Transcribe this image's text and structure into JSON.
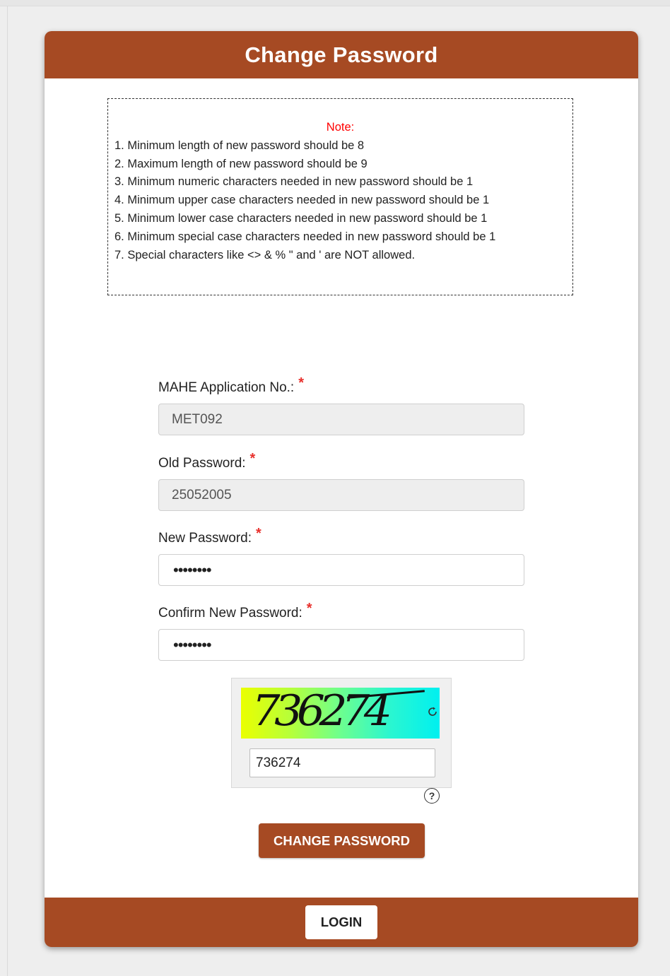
{
  "page": {
    "title": "Change Password"
  },
  "note": {
    "heading": "Note:",
    "lines": [
      "1. Minimum length of new password should be 8",
      "2. Maximum length of new password should be 9",
      "3. Minimum numeric characters needed in new password should be 1",
      "4. Minimum upper case characters needed in new password should be 1",
      "5. Minimum lower case characters needed in new password should be 1",
      "6. Minimum special case characters needed in new password should be 1",
      "7. Special characters like <> & % \" and ' are NOT allowed."
    ]
  },
  "form": {
    "application_no": {
      "label": "MAHE Application No.:",
      "required_mark": "*",
      "value": "MET092"
    },
    "old_password": {
      "label": "Old Password:",
      "required_mark": "*",
      "value": "25052005"
    },
    "new_password": {
      "label": "New Password:",
      "required_mark": "*",
      "masked_value": "••••••••"
    },
    "confirm_password": {
      "label": "Confirm New Password:",
      "required_mark": "*",
      "masked_value": "••••••••"
    }
  },
  "captcha": {
    "image_text": "736274",
    "input_value": "736274",
    "refresh_icon": "refresh-icon",
    "help_symbol": "?"
  },
  "buttons": {
    "change_password": "CHANGE PASSWORD",
    "login": "LOGIN"
  },
  "colors": {
    "brand": "#a64a23",
    "required": "#e8302c",
    "note_heading": "#ff0000"
  }
}
